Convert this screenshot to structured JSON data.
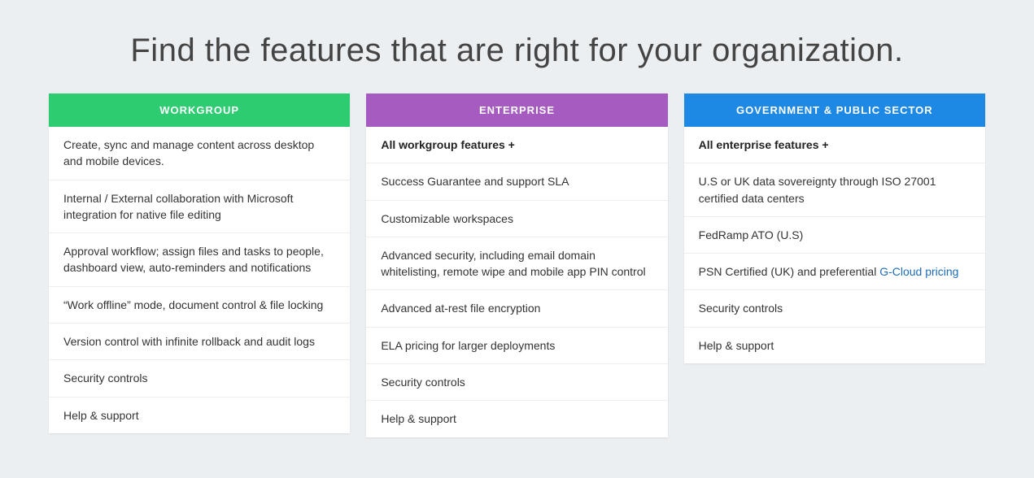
{
  "title": "Find the features that are right for your organization.",
  "columns": [
    {
      "title": "WORKGROUP",
      "headerClass": "hdr-workgroup",
      "name": "plan-workgroup",
      "features": [
        {
          "text": "Create, sync and manage content across desktop and mobile devices."
        },
        {
          "text": "Internal / External collaboration with Microsoft integration for native file editing"
        },
        {
          "text": "Approval workflow; assign files and tasks to people, dashboard view, auto-reminders and notifications"
        },
        {
          "text": "“Work offline” mode, document control & file locking"
        },
        {
          "text": "Version control with infinite rollback and audit logs"
        },
        {
          "text": "Security controls"
        },
        {
          "text": "Help & support"
        }
      ]
    },
    {
      "title": "ENTERPRISE",
      "headerClass": "hdr-enterprise",
      "name": "plan-enterprise",
      "features": [
        {
          "text": "All workgroup features +",
          "bold": true
        },
        {
          "text": "Success Guarantee and support SLA"
        },
        {
          "text": "Customizable workspaces"
        },
        {
          "text": "Advanced security, including email domain whitelisting, remote wipe and mobile app PIN control"
        },
        {
          "text": "Advanced at-rest file encryption"
        },
        {
          "text": "ELA pricing for larger deployments"
        },
        {
          "text": "Security controls"
        },
        {
          "text": "Help & support"
        }
      ]
    },
    {
      "title": "GOVERNMENT & PUBLIC SECTOR",
      "headerClass": "hdr-government",
      "name": "plan-government",
      "features": [
        {
          "text": "All enterprise features +",
          "bold": true
        },
        {
          "text": "U.S or UK data sovereignty through ISO 27001 certified data centers"
        },
        {
          "text": "FedRamp ATO (U.S)"
        },
        {
          "text": "PSN Certified (UK) and preferential ",
          "link_text": "G-Cloud pricing",
          "link": true
        },
        {
          "text": "Security controls"
        },
        {
          "text": "Help & support"
        }
      ]
    }
  ]
}
